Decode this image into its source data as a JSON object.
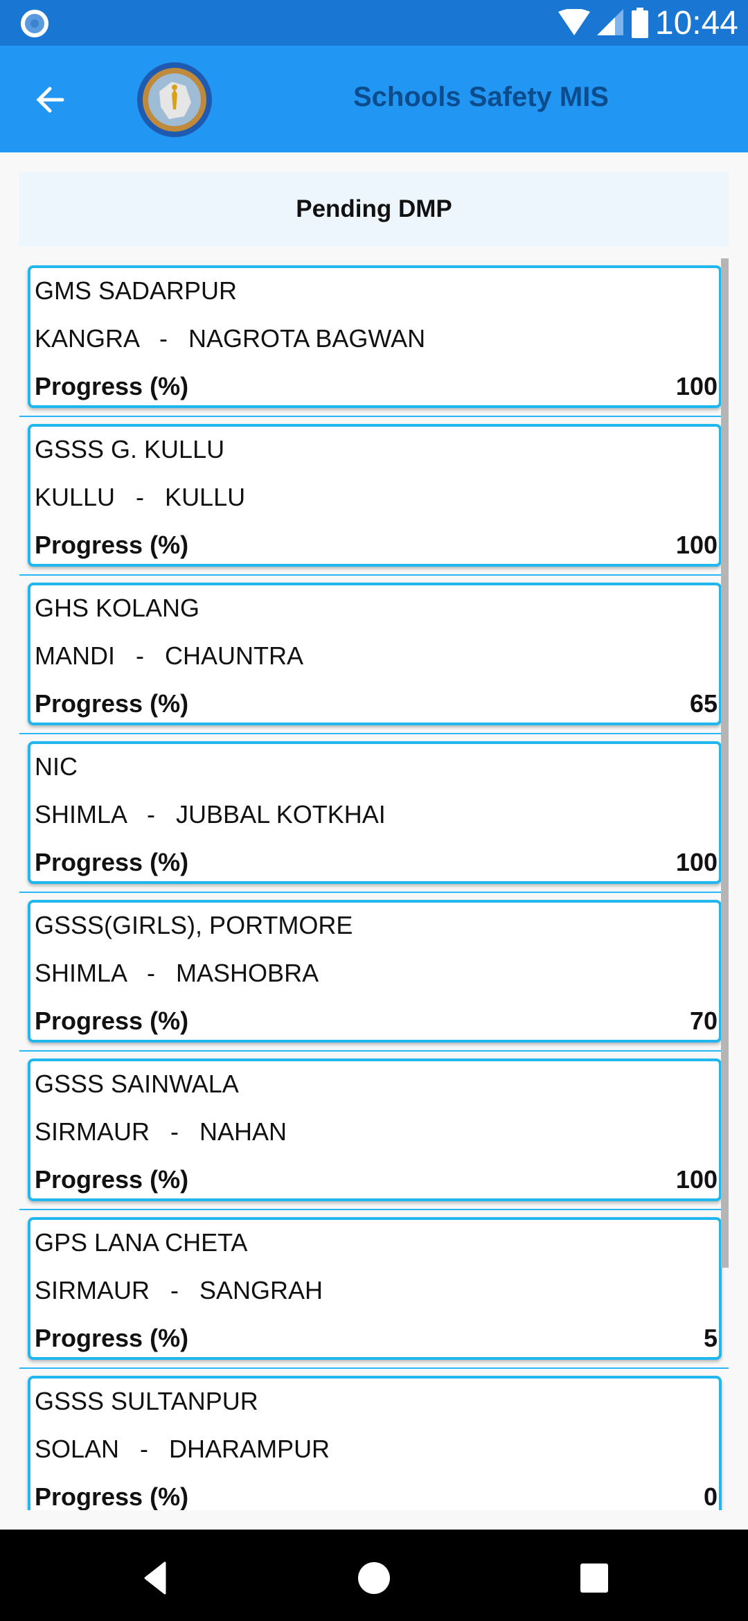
{
  "status_bar": {
    "time": "10:44",
    "icons": [
      "notification-dot-icon",
      "wifi-icon",
      "signal-icon",
      "battery-icon"
    ]
  },
  "app_bar": {
    "back_icon": "arrow-left-icon",
    "logo": "hpsdma-emblem",
    "title": "Schools Safety MIS"
  },
  "page": {
    "heading": "Pending DMP",
    "progress_label": "Progress (%)",
    "separator": "-"
  },
  "schools": [
    {
      "name": "GMS SADARPUR",
      "district": "KANGRA",
      "block": "NAGROTA BAGWAN",
      "progress": "100"
    },
    {
      "name": "GSSS G. KULLU",
      "district": "KULLU",
      "block": "KULLU",
      "progress": "100"
    },
    {
      "name": "GHS KOLANG",
      "district": "MANDI",
      "block": "CHAUNTRA",
      "progress": "65"
    },
    {
      "name": "NIC",
      "district": "SHIMLA",
      "block": "JUBBAL KOTKHAI",
      "progress": "100"
    },
    {
      "name": "GSSS(GIRLS), PORTMORE",
      "district": "SHIMLA",
      "block": "MASHOBRA",
      "progress": "70"
    },
    {
      "name": "GSSS SAINWALA",
      "district": "SIRMAUR",
      "block": "NAHAN",
      "progress": "100"
    },
    {
      "name": "GPS LANA CHETA",
      "district": "SIRMAUR",
      "block": "SANGRAH",
      "progress": "5"
    },
    {
      "name": "GSSS SULTANPUR",
      "district": "SOLAN",
      "block": "DHARAMPUR",
      "progress": "0"
    }
  ],
  "nav_bar": {
    "buttons": [
      "back-triangle-icon",
      "home-circle-icon",
      "recents-square-icon"
    ]
  },
  "colors": {
    "status_bar": "#1976d2",
    "app_bar": "#2196f3",
    "title_text": "#0d4c8c",
    "card_border": "#1fb7ee"
  }
}
